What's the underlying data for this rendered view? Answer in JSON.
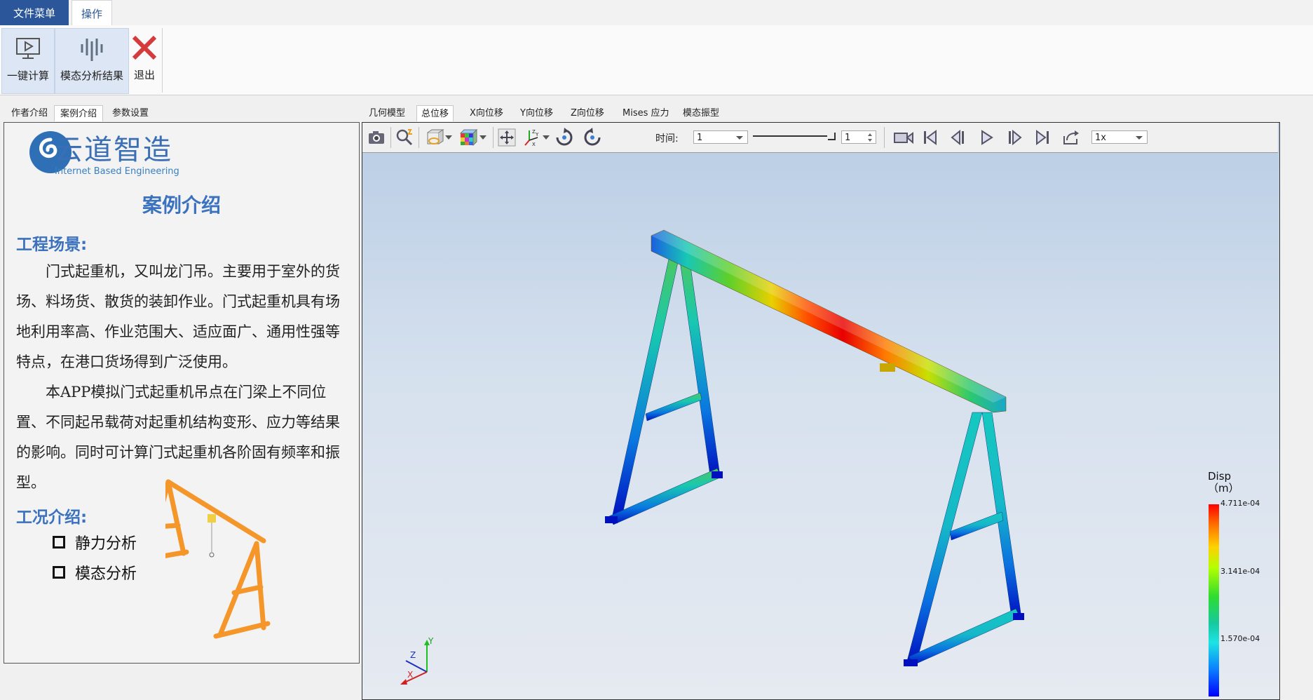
{
  "ribbon": {
    "tabs": [
      {
        "label": "文件菜单"
      },
      {
        "label": "操作"
      }
    ],
    "buttons": [
      {
        "label": "一键计算",
        "icon": "monitor-play-icon"
      },
      {
        "label": "模态分析结果",
        "icon": "waveform-icon"
      },
      {
        "label": "退出",
        "icon": "close-x-icon"
      }
    ]
  },
  "left_panel": {
    "tabs": [
      "作者介绍",
      "案例介绍",
      "参数设置"
    ],
    "active_tab": "案例介绍",
    "logo_text": "云道智造",
    "logo_subtitle": "Internet Based Engineering",
    "title": "案例介绍",
    "section1_heading": "工程场景:",
    "para1": "门式起重机，又叫龙门吊。主要用于室外的货场、料场货、散货的装卸作业。门式起重机具有场地利用率高、作业范围大、适应面广、通用性强等特点，在港口货场得到广泛使用。",
    "para2": "本APP模拟门式起重机吊点在门梁上不同位置、不同起吊载荷对起重机结构变形、应力等结果的影响。同时可计算门式起重机各阶固有频率和振型。",
    "section2_heading": "工况介绍:",
    "options": [
      "静力分析",
      "模态分析"
    ]
  },
  "viewer": {
    "tabs": [
      "几何模型",
      "总位移",
      "X向位移",
      "Y向位移",
      "Z向位移",
      "Mises 应力",
      "模态振型"
    ],
    "active_tab": "总位移",
    "toolbar": {
      "time_label": "时间:",
      "time_value": "1",
      "frame_value": "1",
      "speed_value": "1x"
    },
    "legend": {
      "title_line1": "Disp",
      "title_line2": "（m）",
      "max": "4.711e-04",
      "mid": "3.141e-04",
      "low": "1.570e-04"
    },
    "axes": {
      "z": "Z",
      "y": "Y",
      "x": "X"
    },
    "colors": {
      "accent": "#2b579a",
      "title_blue": "#3a72bf",
      "crane_orange": "#f5962a"
    }
  }
}
